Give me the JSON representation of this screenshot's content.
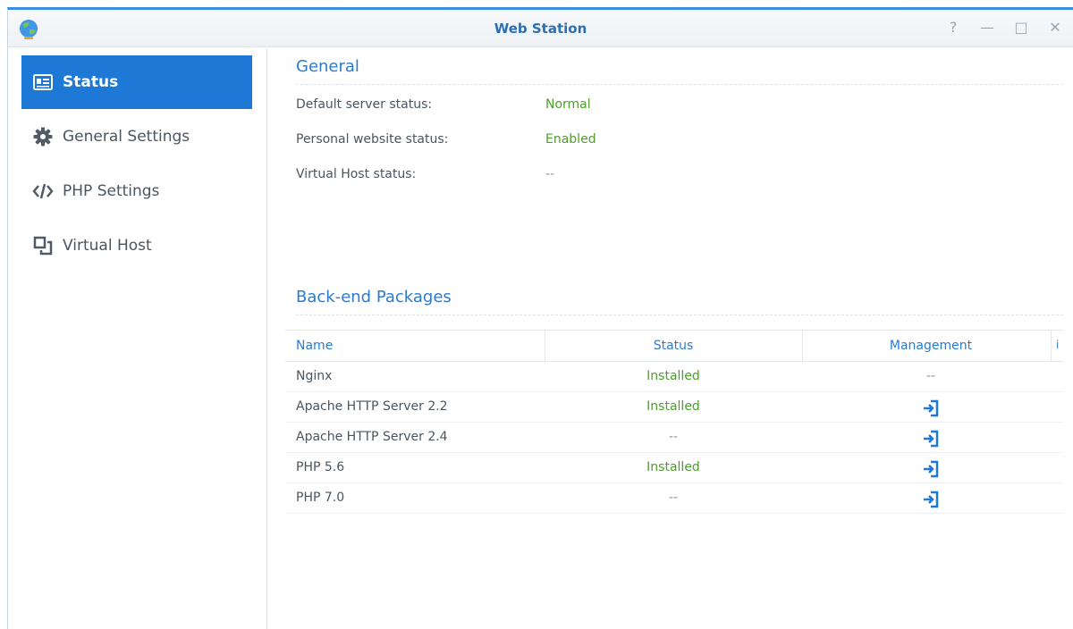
{
  "window": {
    "title": "Web Station",
    "controls": {
      "help": "?",
      "minimize": "—",
      "maximize": "□",
      "close": "✕"
    }
  },
  "sidebar": {
    "items": [
      {
        "label": "Status",
        "icon": "status-card-icon",
        "active": true
      },
      {
        "label": "General Settings",
        "icon": "gear-icon",
        "active": false
      },
      {
        "label": "PHP Settings",
        "icon": "code-icon",
        "active": false
      },
      {
        "label": "Virtual Host",
        "icon": "virtual-host-icon",
        "active": false
      }
    ]
  },
  "general": {
    "title": "General",
    "rows": [
      {
        "label": "Default server status:",
        "value": "Normal"
      },
      {
        "label": "Personal website status:",
        "value": "Enabled"
      },
      {
        "label": "Virtual Host status:",
        "value": "--"
      }
    ]
  },
  "backend": {
    "title": "Back-end Packages",
    "columns": {
      "name": "Name",
      "status": "Status",
      "management": "Management",
      "extra": "i"
    },
    "rows": [
      {
        "name": "Nginx",
        "status": "Installed",
        "management": "--"
      },
      {
        "name": "Apache HTTP Server 2.2",
        "status": "Installed",
        "management": "open-icon"
      },
      {
        "name": "Apache HTTP Server 2.4",
        "status": "--",
        "management": "open-icon"
      },
      {
        "name": "PHP 5.6",
        "status": "Installed",
        "management": "open-icon"
      },
      {
        "name": "PHP 7.0",
        "status": "--",
        "management": "open-icon"
      }
    ]
  },
  "colors": {
    "accent": "#1d78d6",
    "heading": "#2a7bd0",
    "ok": "#4d9d2a"
  }
}
